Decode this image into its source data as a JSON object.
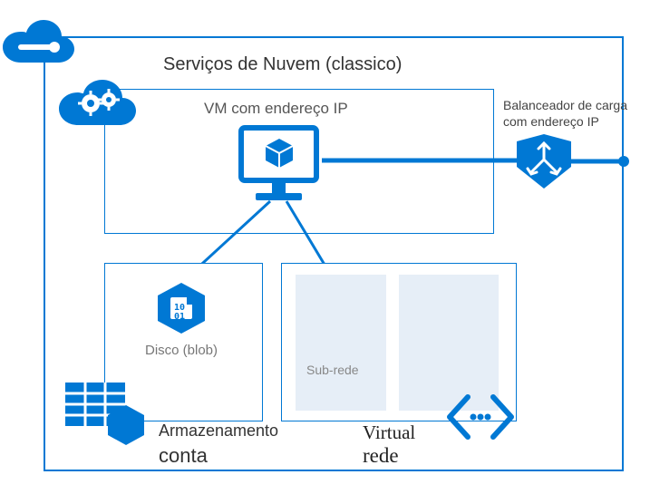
{
  "title": "Serviços de Nuvem (classico)",
  "vm_label": "VM com endereço IP",
  "lb_line1": "Balanceador de carga",
  "lb_line2": "com endereço IP",
  "disk_label": "Disco (blob)",
  "subnet_label": "Sub-rede",
  "storage_line1": "Armazenamento",
  "storage_line2": "conta",
  "vnet_line1": "Virtual",
  "vnet_line2": "rede",
  "colors": {
    "azure": "#0078d4",
    "light": "#e6eef7"
  }
}
